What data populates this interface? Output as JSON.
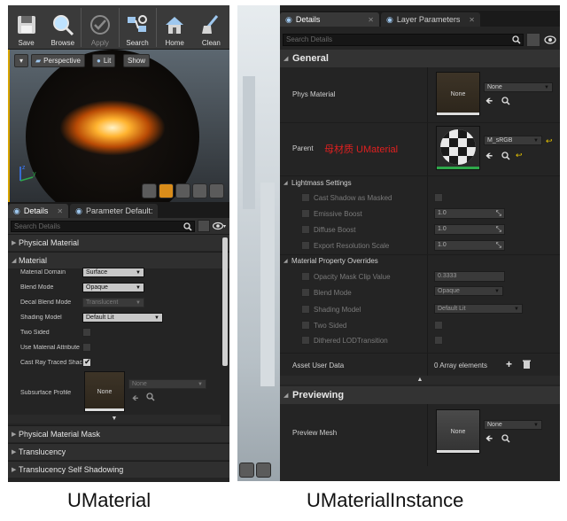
{
  "left": {
    "toolbar": {
      "save": "Save",
      "browse": "Browse",
      "apply": "Apply",
      "search": "Search",
      "home": "Home",
      "clean": "Clean"
    },
    "viewport": {
      "perspective": "Perspective",
      "lit": "Lit",
      "show": "Show"
    },
    "tabs": {
      "details": "Details",
      "parameter_defaults": "Parameter Default:"
    },
    "search_placeholder": "Search Details",
    "categories": {
      "physical_material": "Physical Material",
      "material": "Material",
      "physical_material_mask": "Physical Material Mask",
      "translucency": "Translucency",
      "translucency_self_shadowing": "Translucency Self Shadowing"
    },
    "properties": {
      "material_domain": {
        "label": "Material Domain",
        "value": "Surface"
      },
      "blend_mode": {
        "label": "Blend Mode",
        "value": "Opaque"
      },
      "decal_blend_mode": {
        "label": "Decal Blend Mode",
        "value": "Translucent"
      },
      "shading_model": {
        "label": "Shading Model",
        "value": "Default Lit"
      },
      "two_sided": {
        "label": "Two Sided",
        "checked": false
      },
      "use_material_attributes": {
        "label": "Use Material Attribute",
        "checked": false
      },
      "cast_ray_traced_shadows": {
        "label": "Cast Ray Traced Shac",
        "checked": true
      },
      "subsurface_profile": {
        "label": "Subsurface Profile",
        "thumb": "None",
        "value": "None"
      }
    }
  },
  "right": {
    "tabs": {
      "details": "Details",
      "layer_parameters": "Layer Parameters"
    },
    "search_placeholder": "Search Details",
    "general": {
      "title": "General",
      "phys_material": {
        "label": "Phys Material",
        "thumb": "None",
        "value": "None"
      },
      "parent": {
        "label": "Parent",
        "annotation": "母材质 UMaterial",
        "value": "M_sRGB"
      },
      "lightmass": {
        "title": "Lightmass Settings",
        "cast_shadow_as_masked": "Cast Shadow as Masked",
        "emissive_boost": {
          "label": "Emissive Boost",
          "value": "1.0"
        },
        "diffuse_boost": {
          "label": "Diffuse Boost",
          "value": "1.0"
        },
        "export_resolution_scale": {
          "label": "Export Resolution Scale",
          "value": "1.0"
        }
      },
      "overrides": {
        "title": "Material Property Overrides",
        "opacity_mask_clip_value": {
          "label": "Opacity Mask Clip Value",
          "value": "0.3333"
        },
        "blend_mode": {
          "label": "Blend Mode",
          "value": "Opaque"
        },
        "shading_model": {
          "label": "Shading Model",
          "value": "Default Lit"
        },
        "two_sided": "Two Sided",
        "dithered_lod_transition": "Dithered LODTransition"
      },
      "asset_user_data": {
        "label": "Asset User Data",
        "value": "0 Array elements"
      }
    },
    "previewing": {
      "title": "Previewing",
      "preview_mesh": {
        "label": "Preview Mesh",
        "thumb": "None",
        "value": "None"
      }
    }
  },
  "captions": {
    "left": "UMaterial",
    "right": "UMaterialInstance"
  },
  "colors": {
    "panel_bg": "#242424",
    "category_bg": "#333333",
    "accent_orange": "#d8a400",
    "annotation_red": "#e02020",
    "link_yellow": "#e8c400"
  }
}
